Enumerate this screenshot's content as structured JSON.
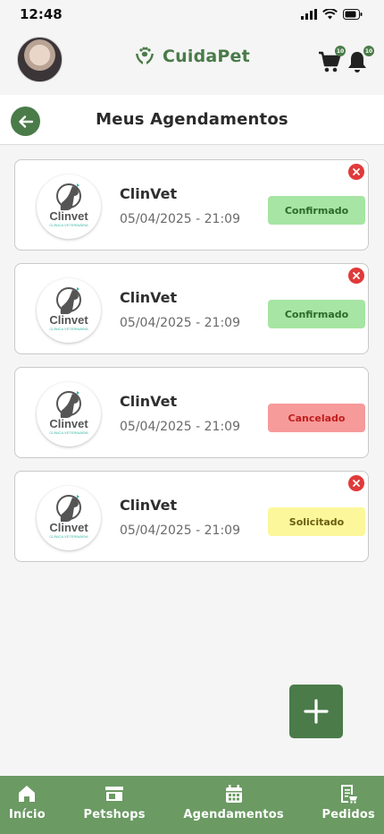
{
  "status_bar": {
    "time": "12:48"
  },
  "header": {
    "brand": "CuidaPet",
    "cart_badge": "10",
    "bell_badge": "10"
  },
  "title_bar": {
    "title": "Meus Agendamentos"
  },
  "logo_text": {
    "main": "Clinvet",
    "sub": "CLÍNICA VETERINÁRIA"
  },
  "appointments": [
    {
      "name": "ClinVet",
      "datetime": "05/04/2025 - 21:09",
      "status": "Confirmado",
      "status_bg": "#a6e5a3",
      "status_color": "#2a6a2a",
      "cancelable": true
    },
    {
      "name": "ClinVet",
      "datetime": "05/04/2025 - 21:09",
      "status": "Confirmado",
      "status_bg": "#a6e5a3",
      "status_color": "#2a6a2a",
      "cancelable": true
    },
    {
      "name": "ClinVet",
      "datetime": "05/04/2025 - 21:09",
      "status": "Cancelado",
      "status_bg": "#f79a9a",
      "status_color": "#c01e1e",
      "cancelable": false
    },
    {
      "name": "ClinVet",
      "datetime": "05/04/2025 - 21:09",
      "status": "Solicitado",
      "status_bg": "#fbf79a",
      "status_color": "#6a5e10",
      "cancelable": true
    }
  ],
  "bottom_nav": [
    {
      "label": "Início",
      "icon": "home-icon"
    },
    {
      "label": "Petshops",
      "icon": "store-icon"
    },
    {
      "label": "Agendamentos",
      "icon": "calendar-icon"
    },
    {
      "label": "Pedidos",
      "icon": "receipt-icon"
    }
  ],
  "colors": {
    "primary": "#4a7b49",
    "nav_bg": "#6b9a63",
    "danger": "#e03a3a"
  }
}
